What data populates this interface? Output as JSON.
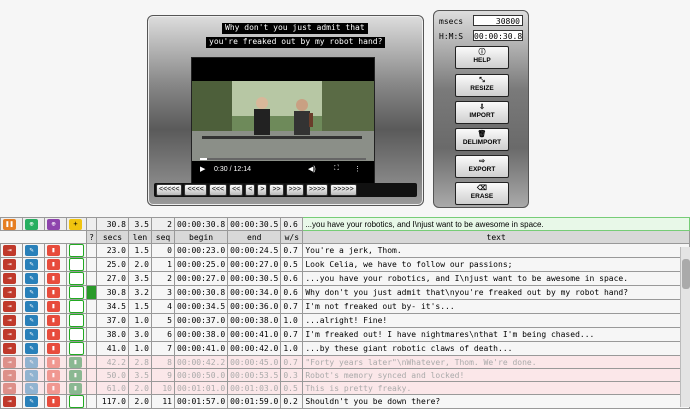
{
  "player": {
    "subtitle_line1": "Why don't you just admit that",
    "subtitle_line2": "you're freaked out by my robot hand?",
    "time_display": "0:30 / 12:14",
    "nav_buttons": [
      "<<<<<",
      "<<<<",
      "<<<",
      "<<",
      "<",
      ">",
      ">>",
      ">>>",
      ">>>>",
      ">>>>>"
    ]
  },
  "control": {
    "msecs_label": "msecs",
    "msecs_value": "30800",
    "hms_label": "H:M:S",
    "hms_value": "00:00:30.8",
    "buttons": [
      {
        "icon": "info-icon",
        "glyph": "ⓘ",
        "label": "HELP"
      },
      {
        "icon": "resize-icon",
        "glyph": "⤡",
        "label": "RESIZE"
      },
      {
        "icon": "import-icon",
        "glyph": "⇩",
        "label": "IMPORT"
      },
      {
        "icon": "trash-icon",
        "glyph": "🗑",
        "label": "DELIMPORT"
      },
      {
        "icon": "export-icon",
        "glyph": "⇨",
        "label": "EXPORT"
      },
      {
        "icon": "eraser-icon",
        "glyph": "⌫",
        "label": "ERASE"
      }
    ]
  },
  "current": {
    "secs": "30.8",
    "len": "3.5",
    "seq": "2",
    "begin": "00:00:30.8",
    "end": "00:00:30.5",
    "ws": "0.6",
    "text": "...you have your robotics, and I\\njust want to be awesome in space."
  },
  "headers": {
    "q": "?",
    "secs": "secs",
    "len": "len",
    "seq": "seq",
    "begin": "begin",
    "end": "end",
    "ws": "w/s",
    "text": "text"
  },
  "rows": [
    {
      "secs": "23.0",
      "len": "1.5",
      "seq": "0",
      "begin": "00:00:23.0",
      "end": "00:00:24.5",
      "ws": "0.7",
      "text": "You're a jerk, Thom.",
      "faded": false,
      "mark": false
    },
    {
      "secs": "25.0",
      "len": "2.0",
      "seq": "1",
      "begin": "00:00:25.0",
      "end": "00:00:27.0",
      "ws": "0.5",
      "text": "Look Celia, we have to follow our passions;",
      "faded": false,
      "mark": false
    },
    {
      "secs": "27.0",
      "len": "3.5",
      "seq": "2",
      "begin": "00:00:27.0",
      "end": "00:00:30.5",
      "ws": "0.6",
      "text": "...you have your robotics, and I\\njust want to be awesome in space.",
      "faded": false,
      "mark": false
    },
    {
      "secs": "30.8",
      "len": "3.2",
      "seq": "3",
      "begin": "00:00:30.8",
      "end": "00:00:34.0",
      "ws": "0.6",
      "text": "Why don't you just admit that\\nyou're freaked out by my robot hand?",
      "faded": false,
      "mark": true
    },
    {
      "secs": "34.5",
      "len": "1.5",
      "seq": "4",
      "begin": "00:00:34.5",
      "end": "00:00:36.0",
      "ws": "0.7",
      "text": "I'm not freaked out by- it's...",
      "faded": false,
      "mark": false
    },
    {
      "secs": "37.0",
      "len": "1.0",
      "seq": "5",
      "begin": "00:00:37.0",
      "end": "00:00:38.0",
      "ws": "1.0",
      "text": "...alright! Fine!",
      "faded": false,
      "mark": false
    },
    {
      "secs": "38.0",
      "len": "3.0",
      "seq": "6",
      "begin": "00:00:38.0",
      "end": "00:00:41.0",
      "ws": "0.7",
      "text": "I'm freaked out! I have nightmares\\nthat I'm being chased...",
      "faded": false,
      "mark": false
    },
    {
      "secs": "41.0",
      "len": "1.0",
      "seq": "7",
      "begin": "00:00:41.0",
      "end": "00:00:42.0",
      "ws": "1.0",
      "text": "...by these giant robotic claws of death...",
      "faded": false,
      "mark": false
    },
    {
      "secs": "42.2",
      "len": "2.8",
      "seq": "8",
      "begin": "00:00:42.2",
      "end": "00:00:45.0",
      "ws": "0.7",
      "text": "\"Forty years later\"\\nWhatever, Thom. We're done.",
      "faded": true,
      "mark": false
    },
    {
      "secs": "50.0",
      "len": "3.5",
      "seq": "9",
      "begin": "00:00:50.0",
      "end": "00:00:53.5",
      "ws": "0.3",
      "text": "Robot's memory synced and locked!",
      "faded": true,
      "mark": false
    },
    {
      "secs": "61.0",
      "len": "2.0",
      "seq": "10",
      "begin": "00:01:01.0",
      "end": "00:01:03.0",
      "ws": "0.5",
      "text": "This is pretty freaky.",
      "faded": true,
      "mark": false
    },
    {
      "secs": "117.0",
      "len": "2.0",
      "seq": "11",
      "begin": "00:01:57.0",
      "end": "00:01:59.0",
      "ws": "0.2",
      "text": "Shouldn't you be down there?",
      "faded": false,
      "mark": false
    }
  ]
}
